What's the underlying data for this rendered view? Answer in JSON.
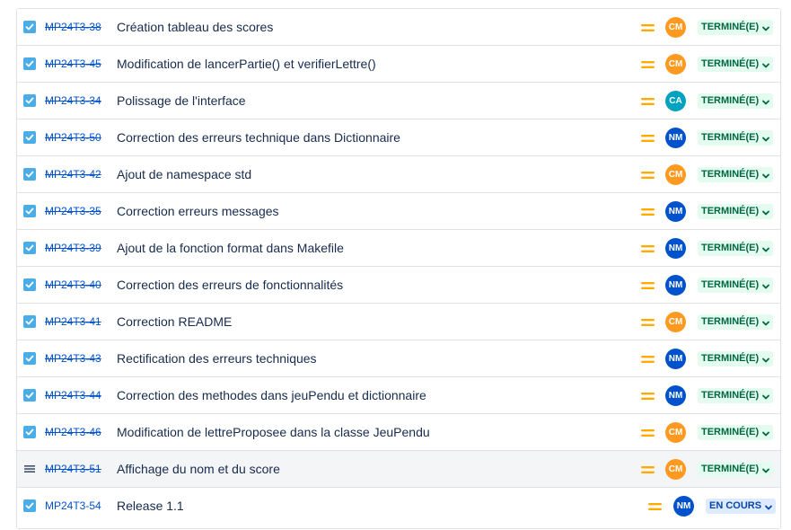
{
  "issues": [
    {
      "key": "MP24T3-38",
      "summary": "Création tableau des scores",
      "type": "task",
      "done": true,
      "assignee": "CM",
      "assignee_color": "#ff991f",
      "status": "TERMINÉ(E)",
      "status_kind": "done"
    },
    {
      "key": "MP24T3-45",
      "summary": "Modification de lancerPartie() et verifierLettre()",
      "type": "task",
      "done": true,
      "assignee": "CM",
      "assignee_color": "#ff991f",
      "status": "TERMINÉ(E)",
      "status_kind": "done"
    },
    {
      "key": "MP24T3-34",
      "summary": "Polissage de l'interface",
      "type": "task",
      "done": true,
      "assignee": "CA",
      "assignee_color": "#00a3bf",
      "status": "TERMINÉ(E)",
      "status_kind": "done"
    },
    {
      "key": "MP24T3-50",
      "summary": "Correction des erreurs technique dans Dictionnaire",
      "type": "task",
      "done": true,
      "assignee": "NM",
      "assignee_color": "#0052cc",
      "status": "TERMINÉ(E)",
      "status_kind": "done"
    },
    {
      "key": "MP24T3-42",
      "summary": "Ajout de namespace std",
      "type": "task",
      "done": true,
      "assignee": "CM",
      "assignee_color": "#ff991f",
      "status": "TERMINÉ(E)",
      "status_kind": "done"
    },
    {
      "key": "MP24T3-35",
      "summary": "Correction erreurs messages",
      "type": "task",
      "done": true,
      "assignee": "NM",
      "assignee_color": "#0052cc",
      "status": "TERMINÉ(E)",
      "status_kind": "done"
    },
    {
      "key": "MP24T3-39",
      "summary": "Ajout de la fonction format dans Makefile",
      "type": "task",
      "done": true,
      "assignee": "NM",
      "assignee_color": "#0052cc",
      "status": "TERMINÉ(E)",
      "status_kind": "done"
    },
    {
      "key": "MP24T3-40",
      "summary": "Correction des erreurs de fonctionnalités",
      "type": "task",
      "done": true,
      "assignee": "NM",
      "assignee_color": "#0052cc",
      "status": "TERMINÉ(E)",
      "status_kind": "done"
    },
    {
      "key": "MP24T3-41",
      "summary": "Correction README",
      "type": "task",
      "done": true,
      "assignee": "CM",
      "assignee_color": "#ff991f",
      "status": "TERMINÉ(E)",
      "status_kind": "done"
    },
    {
      "key": "MP24T3-43",
      "summary": "Rectification des erreurs techniques",
      "type": "task",
      "done": true,
      "assignee": "NM",
      "assignee_color": "#0052cc",
      "status": "TERMINÉ(E)",
      "status_kind": "done"
    },
    {
      "key": "MP24T3-44",
      "summary": "Correction des methodes dans jeuPendu et dictionnaire",
      "type": "task",
      "done": true,
      "assignee": "NM",
      "assignee_color": "#0052cc",
      "status": "TERMINÉ(E)",
      "status_kind": "done"
    },
    {
      "key": "MP24T3-46",
      "summary": "Modification de lettreProposee dans la classe JeuPendu",
      "type": "task",
      "done": true,
      "assignee": "CM",
      "assignee_color": "#ff991f",
      "status": "TERMINÉ(E)",
      "status_kind": "done"
    },
    {
      "key": "MP24T3-51",
      "summary": "Affichage du nom et du score",
      "type": "drag-handle",
      "done": true,
      "hover": true,
      "assignee": "CM",
      "assignee_color": "#ff991f",
      "status": "TERMINÉ(E)",
      "status_kind": "done"
    },
    {
      "key": "MP24T3-54",
      "summary": "Release 1.1",
      "type": "task",
      "done": false,
      "assignee": "NM",
      "assignee_color": "#0052cc",
      "status": "EN COURS",
      "status_kind": "progress",
      "last": true
    }
  ],
  "colors": {
    "priority_medium": "#ffab00",
    "link": "#0052cc"
  },
  "icons": {
    "priority": "priority-medium-icon",
    "task": "task-checkbox-icon",
    "drag": "drag-handle-icon",
    "dropdown": "chevron-down-icon"
  }
}
